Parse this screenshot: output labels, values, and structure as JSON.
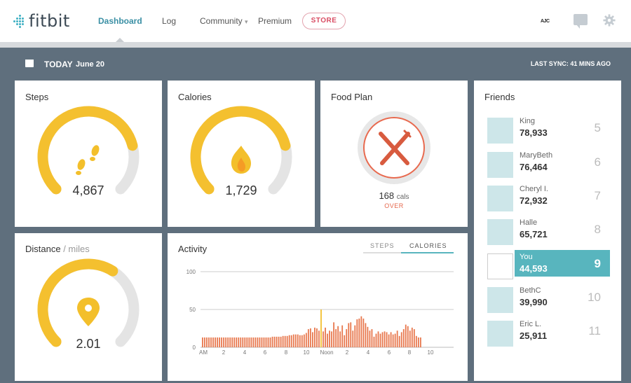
{
  "nav": {
    "brand": "fitbit",
    "items": [
      {
        "label": "Dashboard",
        "active": true
      },
      {
        "label": "Log",
        "active": false
      },
      {
        "label": "Community",
        "active": false
      },
      {
        "label": "Premium",
        "active": false
      }
    ],
    "community_caret": "▾",
    "store_label": "STORE",
    "user_badge": "AJC",
    "colors": {
      "accent": "#3a8fa4",
      "store": "#d94b62"
    }
  },
  "datebar": {
    "today": "TODAY",
    "date": "June 20",
    "sync": "LAST SYNC: 41 MINS AGO"
  },
  "steps": {
    "title": "Steps",
    "value": "4,867",
    "progress": 0.78,
    "icon": "footprints-icon"
  },
  "calories": {
    "title": "Calories",
    "value": "1,729",
    "progress": 0.78,
    "icon": "flame-icon"
  },
  "food": {
    "title": "Food Plan",
    "value": "168",
    "unit": "cals",
    "status": "OVER",
    "icon": "fork-knife-icon"
  },
  "distance": {
    "title": "Distance",
    "subtitle": "/ miles",
    "value": "2.01",
    "progress": 0.62,
    "icon": "map-pin-icon"
  },
  "activity": {
    "title": "Activity",
    "tabs": [
      {
        "label": "STEPS",
        "active": false
      },
      {
        "label": "CALORIES",
        "active": true
      }
    ],
    "chart_data": {
      "type": "bar",
      "title": "",
      "xlabel": "",
      "ylabel": "",
      "ylim": [
        0,
        100
      ],
      "yticks": [
        "0",
        "50",
        "100"
      ],
      "x_tick_labels": [
        "AM",
        "2",
        "4",
        "6",
        "8",
        "10",
        "Noon",
        "2",
        "4",
        "6",
        "8",
        "10"
      ],
      "highlight_color": "#f3c031",
      "bar_color": "#e8794f",
      "values": [
        13,
        13,
        13,
        13,
        13,
        13,
        13,
        13,
        13,
        13,
        13,
        13,
        13,
        13,
        13,
        13,
        13,
        13,
        13,
        13,
        13,
        13,
        13,
        13,
        13,
        13,
        13,
        13,
        13,
        13,
        13,
        13,
        13,
        14,
        14,
        14,
        14,
        14,
        15,
        15,
        15,
        16,
        16,
        17,
        17,
        17,
        16,
        16,
        17,
        19,
        24,
        25,
        20,
        26,
        25,
        22,
        50,
        21,
        26,
        18,
        22,
        21,
        33,
        24,
        28,
        21,
        29,
        16,
        24,
        32,
        33,
        22,
        29,
        37,
        38,
        41,
        38,
        32,
        27,
        22,
        24,
        14,
        18,
        21,
        18,
        20,
        21,
        20,
        17,
        20,
        17,
        18,
        22,
        15,
        20,
        24,
        30,
        28,
        22,
        26,
        24,
        15,
        13,
        13
      ]
    }
  },
  "friends": {
    "title": "Friends",
    "list": [
      {
        "name": "King",
        "steps": "78,933",
        "rank": "5",
        "me": false
      },
      {
        "name": "MaryBeth",
        "steps": "76,464",
        "rank": "6",
        "me": false
      },
      {
        "name": "Cheryl I.",
        "steps": "72,932",
        "rank": "7",
        "me": false
      },
      {
        "name": "Halle",
        "steps": "65,721",
        "rank": "8",
        "me": false
      },
      {
        "name": "You",
        "steps": "44,593",
        "rank": "9",
        "me": true
      },
      {
        "name": "BethC",
        "steps": "39,990",
        "rank": "10",
        "me": false
      },
      {
        "name": "Eric L.",
        "steps": "25,911",
        "rank": "11",
        "me": false
      }
    ],
    "colors": {
      "me": "#58b5be"
    }
  }
}
